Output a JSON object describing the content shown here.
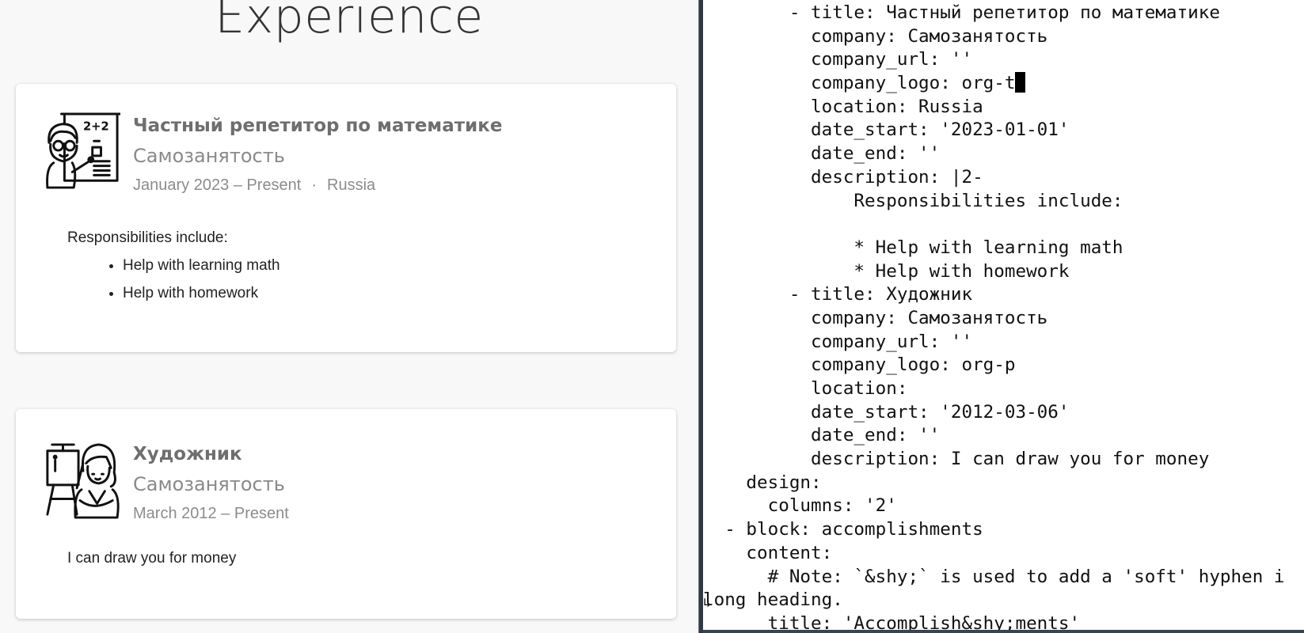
{
  "preview": {
    "section_title": "Experience",
    "experiences": [
      {
        "title": "Частный репетитор по математике",
        "company": "Самозанятость",
        "dates": "January 2023 – Present",
        "separator": "·",
        "location": "Russia",
        "logo_icon": "math-tutor-icon",
        "description_intro": "Responsibilities include:",
        "description_items": [
          "Help with learning math",
          "Help with homework"
        ]
      },
      {
        "title": "Художник",
        "company": "Самозанятость",
        "dates": "March 2012 – Present",
        "logo_icon": "painter-icon",
        "description_intro": "I can draw you for money"
      }
    ]
  },
  "editor": {
    "lines": [
      "        - title: Частный репетитор по математике",
      "          company: Самозанятость",
      "          company_url: ''",
      "          company_logo: org-t",
      "          location: Russia",
      "          date_start: '2023-01-01'",
      "          date_end: ''",
      "          description: |2-",
      "              Responsibilities include:",
      "",
      "              * Help with learning math",
      "              * Help with homework",
      "        - title: Художник",
      "          company: Самозанятость",
      "          company_url: ''",
      "          company_logo: org-p",
      "          location:",
      "          date_start: '2012-03-06'",
      "          date_end: ''",
      "          description: I can draw you for money",
      "    design:",
      "      columns: '2'",
      "  - block: accomplishments",
      "    content:",
      "      # Note: `&shy;` is used to add a 'soft' hyphen i",
      "long heading.",
      "      title: 'Accomplish&shy;ments'"
    ],
    "cursor_line": 3,
    "wrap_marker": "↳"
  },
  "colors": {
    "preview_bg": "#f8f8f8",
    "title_text": "#6e6e6e",
    "company_text": "#8a8a8a",
    "divider": "#2f3a45"
  }
}
